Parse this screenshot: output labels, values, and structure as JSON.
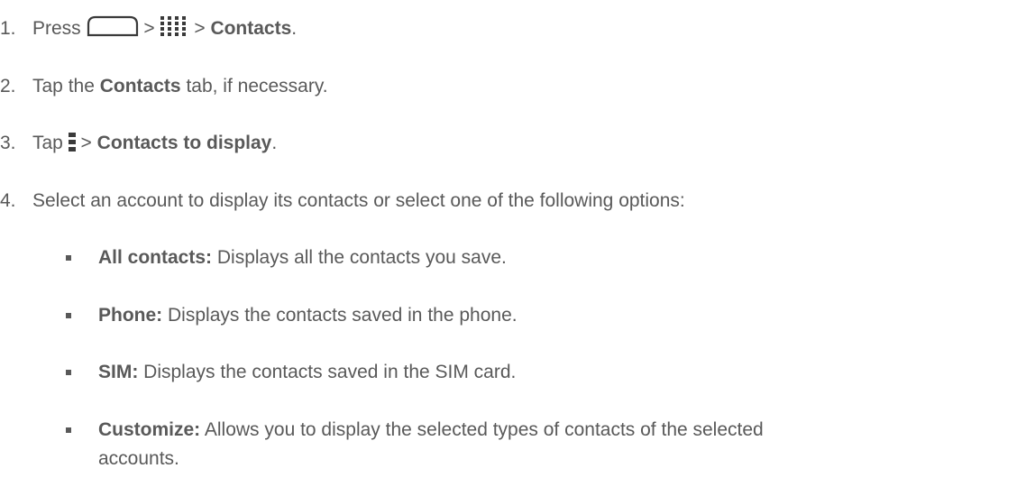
{
  "steps": [
    {
      "number": "1.",
      "press": "Press",
      "sep1": ">",
      "sep2": ">",
      "target": "Contacts",
      "end": "."
    },
    {
      "number": "2.",
      "pre": "Tap the",
      "target": "Contacts",
      "post": "tab, if necessary."
    },
    {
      "number": "3.",
      "pre": "Tap",
      "sep": ">",
      "target": "Contacts to display",
      "end": "."
    },
    {
      "number": "4.",
      "text": "Select an account to display its contacts or select one of the following options:"
    }
  ],
  "options": [
    {
      "label": "All contacts:",
      "desc": "Displays all the contacts you save."
    },
    {
      "label": "Phone:",
      "desc": "Displays the contacts saved in the phone."
    },
    {
      "label": "SIM:",
      "desc": "Displays the contacts saved in the SIM card."
    },
    {
      "label": "Customize:",
      "desc": "Allows you to display the selected types of contacts of the selected",
      "desc_cont": "accounts."
    }
  ],
  "icons": {
    "home": "home-icon",
    "apps": "apps-grid-icon",
    "menu": "menu-icon"
  },
  "colors": {
    "text": "#595959"
  }
}
